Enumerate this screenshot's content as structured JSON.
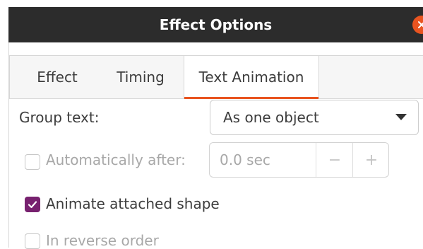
{
  "window": {
    "title": "Effect Options"
  },
  "tabs": [
    {
      "label": "Effect"
    },
    {
      "label": "Timing"
    },
    {
      "label": "Text Animation"
    }
  ],
  "active_tab": "Text Animation",
  "group_text": {
    "label": "Group text:",
    "value": "As one object"
  },
  "auto_after": {
    "label": "Automatically after:",
    "checked": false,
    "enabled": false,
    "value": "0.0 sec",
    "minus": "−",
    "plus": "+"
  },
  "animate_shape": {
    "label": "Animate attached shape",
    "checked": true
  },
  "reverse_order": {
    "label": "In reverse order",
    "checked": false,
    "enabled": false
  },
  "colors": {
    "accent": "#e95420",
    "checkbox_checked": "#77216f",
    "titlebar": "#2c2c2c"
  }
}
